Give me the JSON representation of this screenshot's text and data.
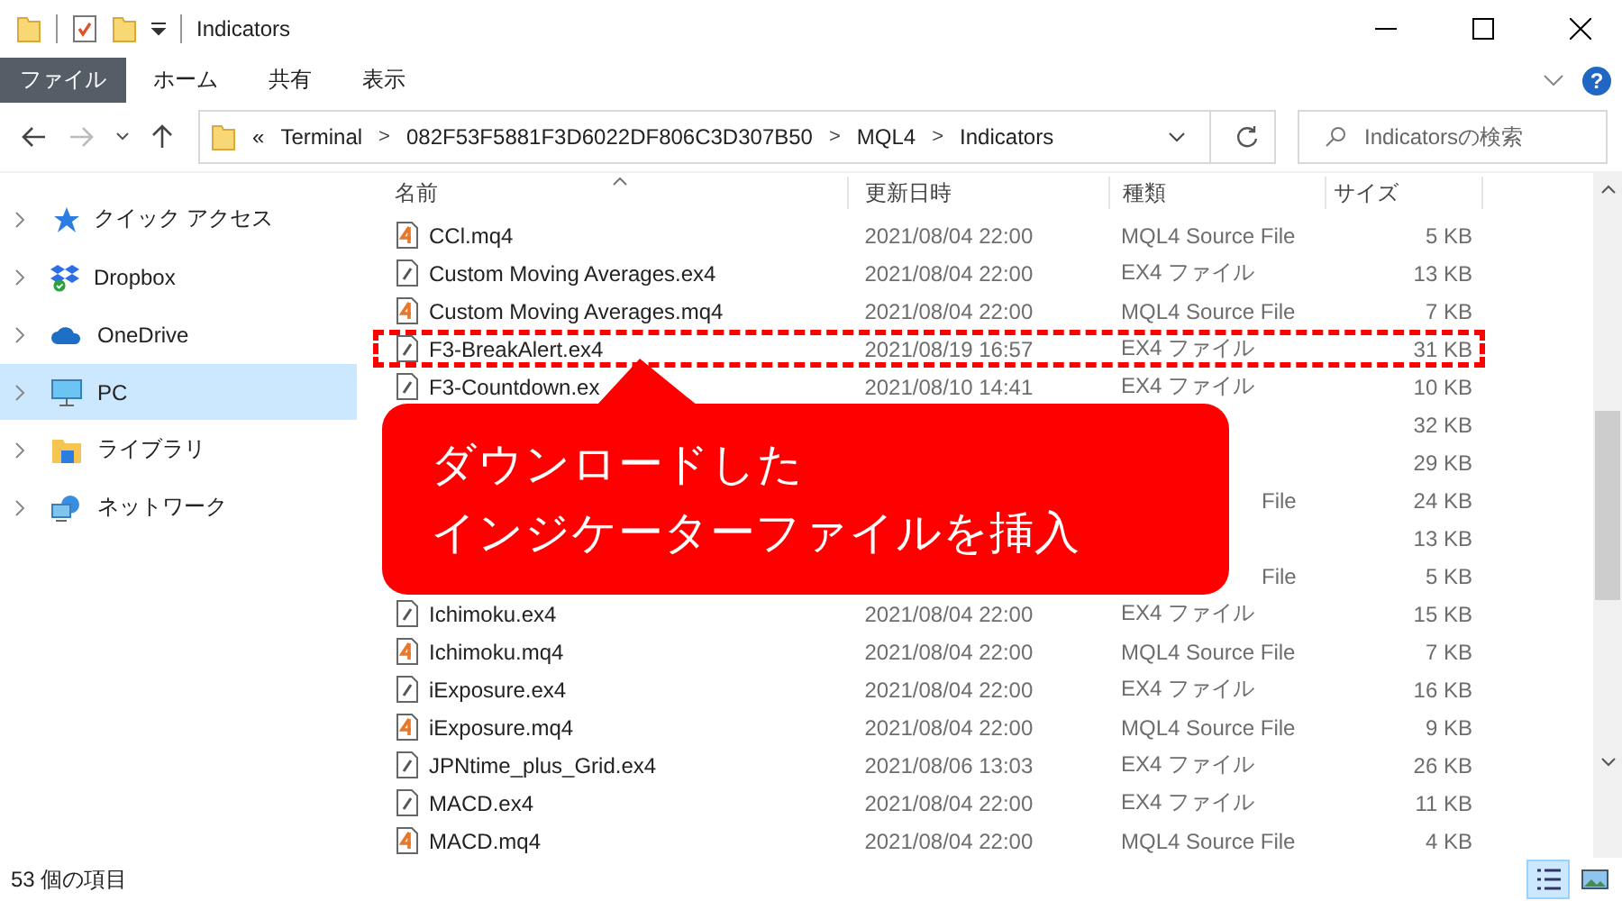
{
  "window": {
    "title": "Indicators"
  },
  "ribbon": {
    "tabs": [
      {
        "label": "ファイル",
        "selected": true
      },
      {
        "label": "ホーム",
        "selected": false
      },
      {
        "label": "共有",
        "selected": false
      },
      {
        "label": "表示",
        "selected": false
      }
    ],
    "help": "?"
  },
  "address": {
    "overflow": "«",
    "crumbs": [
      "Terminal",
      "082F53F5881F3D6022DF806C3D307B50",
      "MQL4",
      "Indicators"
    ],
    "separator": ">"
  },
  "search": {
    "placeholder": "Indicatorsの検索"
  },
  "sidebar": {
    "items": [
      {
        "label": "クイック アクセス",
        "kind": "star",
        "selected": false
      },
      {
        "label": "Dropbox",
        "kind": "dropbox",
        "selected": false
      },
      {
        "label": "OneDrive",
        "kind": "cloud",
        "selected": false
      },
      {
        "label": "PC",
        "kind": "monitor",
        "selected": true
      },
      {
        "label": "ライブラリ",
        "kind": "library",
        "selected": false
      },
      {
        "label": "ネットワーク",
        "kind": "network",
        "selected": false
      }
    ]
  },
  "table": {
    "columns": [
      "名前",
      "更新日時",
      "種類",
      "サイズ"
    ],
    "rows": [
      {
        "kind": "mq4",
        "name": "CCl.mq4",
        "date": "2021/08/04 22:00",
        "type": "MQL4 Source File",
        "size": "5 KB",
        "highlighted": false
      },
      {
        "kind": "ex4",
        "name": "Custom Moving Averages.ex4",
        "date": "2021/08/04 22:00",
        "type": "EX4 ファイル",
        "size": "13 KB",
        "highlighted": false
      },
      {
        "kind": "mq4",
        "name": "Custom Moving Averages.mq4",
        "date": "2021/08/04 22:00",
        "type": "MQL4 Source File",
        "size": "7 KB",
        "highlighted": false
      },
      {
        "kind": "ex4",
        "name": "F3-BreakAlert.ex4",
        "date": "2021/08/19 16:57",
        "type": "EX4 ファイル",
        "size": "31 KB",
        "highlighted": true
      },
      {
        "kind": "ex4",
        "name": "F3-Countdown.ex",
        "date": "2021/08/10 14:41",
        "type": "EX4 ファイル",
        "size": "10 KB",
        "highlighted": false
      },
      {
        "size": "32 KB",
        "highlighted": false
      },
      {
        "size": "29 KB",
        "highlighted": false
      },
      {
        "type_tail": "File",
        "size": "24 KB",
        "highlighted": false
      },
      {
        "size": "13 KB",
        "highlighted": false
      },
      {
        "type_tail": "File",
        "size": "5 KB",
        "highlighted": false
      },
      {
        "kind": "ex4",
        "name": "Ichimoku.ex4",
        "date": "2021/08/04 22:00",
        "type": "EX4 ファイル",
        "size": "15 KB",
        "highlighted": false
      },
      {
        "kind": "mq4",
        "name": "Ichimoku.mq4",
        "date": "2021/08/04 22:00",
        "type": "MQL4 Source File",
        "size": "7 KB",
        "highlighted": false
      },
      {
        "kind": "ex4",
        "name": "iExposure.ex4",
        "date": "2021/08/04 22:00",
        "type": "EX4 ファイル",
        "size": "16 KB",
        "highlighted": false
      },
      {
        "kind": "mq4",
        "name": "iExposure.mq4",
        "date": "2021/08/04 22:00",
        "type": "MQL4 Source File",
        "size": "9 KB",
        "highlighted": false
      },
      {
        "kind": "ex4",
        "name": "JPNtime_plus_Grid.ex4",
        "date": "2021/08/06 13:03",
        "type": "EX4 ファイル",
        "size": "26 KB",
        "highlighted": false
      },
      {
        "kind": "ex4",
        "name": "MACD.ex4",
        "date": "2021/08/04 22:00",
        "type": "EX4 ファイル",
        "size": "11 KB",
        "highlighted": false
      },
      {
        "kind": "mq4",
        "name": "MACD.mq4",
        "date": "2021/08/04 22:00",
        "type": "MQL4 Source File",
        "size": "4 KB",
        "highlighted": false
      }
    ]
  },
  "callout": {
    "lines": [
      "ダウンロードした",
      "インジケーターファイルを挿入"
    ]
  },
  "status_bar": {
    "count": "53 個の項目"
  }
}
